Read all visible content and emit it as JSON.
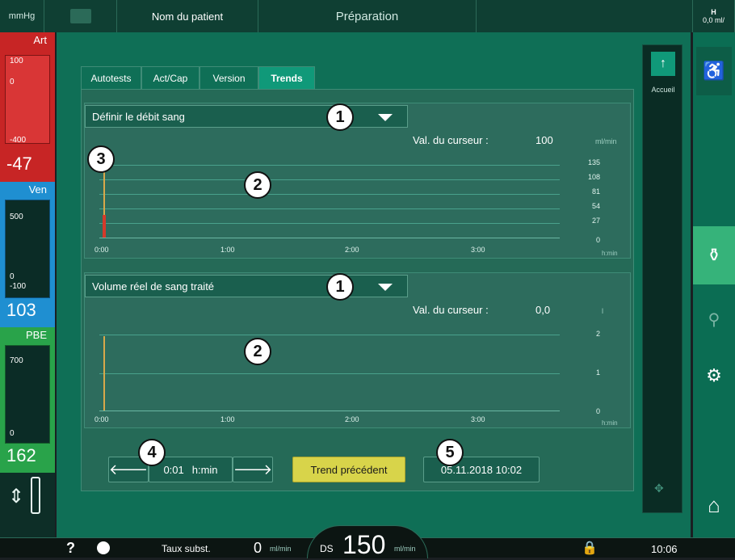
{
  "header": {
    "unit": "mmHg",
    "patient_label": "Nom du patient",
    "mode": "Préparation",
    "right_top": "0,0  ml/",
    "right_icon_label": "H"
  },
  "left": {
    "art": {
      "label": "Art",
      "scale_top": "100",
      "scale_zero": "0",
      "scale_bottom": "-400",
      "value": "-47"
    },
    "ven": {
      "label": "Ven",
      "scale_top": "500",
      "scale_zero": "0",
      "scale_bottom": "-100",
      "value": "103"
    },
    "pbe": {
      "label": "PBE",
      "scale_top": "700",
      "scale_zero": "0",
      "value": "162"
    }
  },
  "tabs": [
    {
      "label": "Autotests"
    },
    {
      "label": "Act/Cap"
    },
    {
      "label": "Version"
    },
    {
      "label": "Trends"
    }
  ],
  "chart_top": {
    "dropdown": "Définir le débit sang",
    "cursor_label": "Val. du curseur :",
    "cursor_value": "100",
    "unit": "ml/min",
    "y_ticks": [
      "135",
      "108",
      "81",
      "54",
      "27",
      "0"
    ],
    "x_ticks": [
      "0:00",
      "1:00",
      "2:00",
      "3:00"
    ],
    "x_unit": "h:min"
  },
  "chart_bottom": {
    "dropdown": "Volume réel de sang traité",
    "cursor_label": "Val. du curseur :",
    "cursor_value": "0,0",
    "unit": "l",
    "y_ticks": [
      "2",
      "1",
      "0"
    ],
    "x_ticks": [
      "0:00",
      "1:00",
      "2:00",
      "3:00"
    ],
    "x_unit": "h:min"
  },
  "controls": {
    "time_value": "0:01",
    "time_unit": "h:min",
    "prev_trend": "Trend précédent",
    "datetime": "05.11.2018 10:02"
  },
  "callouts": {
    "c1": "1",
    "c2": "2",
    "c3": "3",
    "c4": "4",
    "c5": "5"
  },
  "sidebar": {
    "home_label": "Accueil"
  },
  "bottom": {
    "help": "?",
    "subst_label": "Taux subst.",
    "subst_value": "0",
    "subst_unit": "ml/min",
    "ds_label": "DS",
    "ds_value": "150",
    "ds_unit": "ml/min",
    "time": "10:06"
  },
  "colors": {
    "accent": "#0f6f56",
    "yellow": "#d8d44a",
    "red": "#cf2a2a",
    "blue": "#1f8fd1",
    "green": "#29a34a"
  }
}
